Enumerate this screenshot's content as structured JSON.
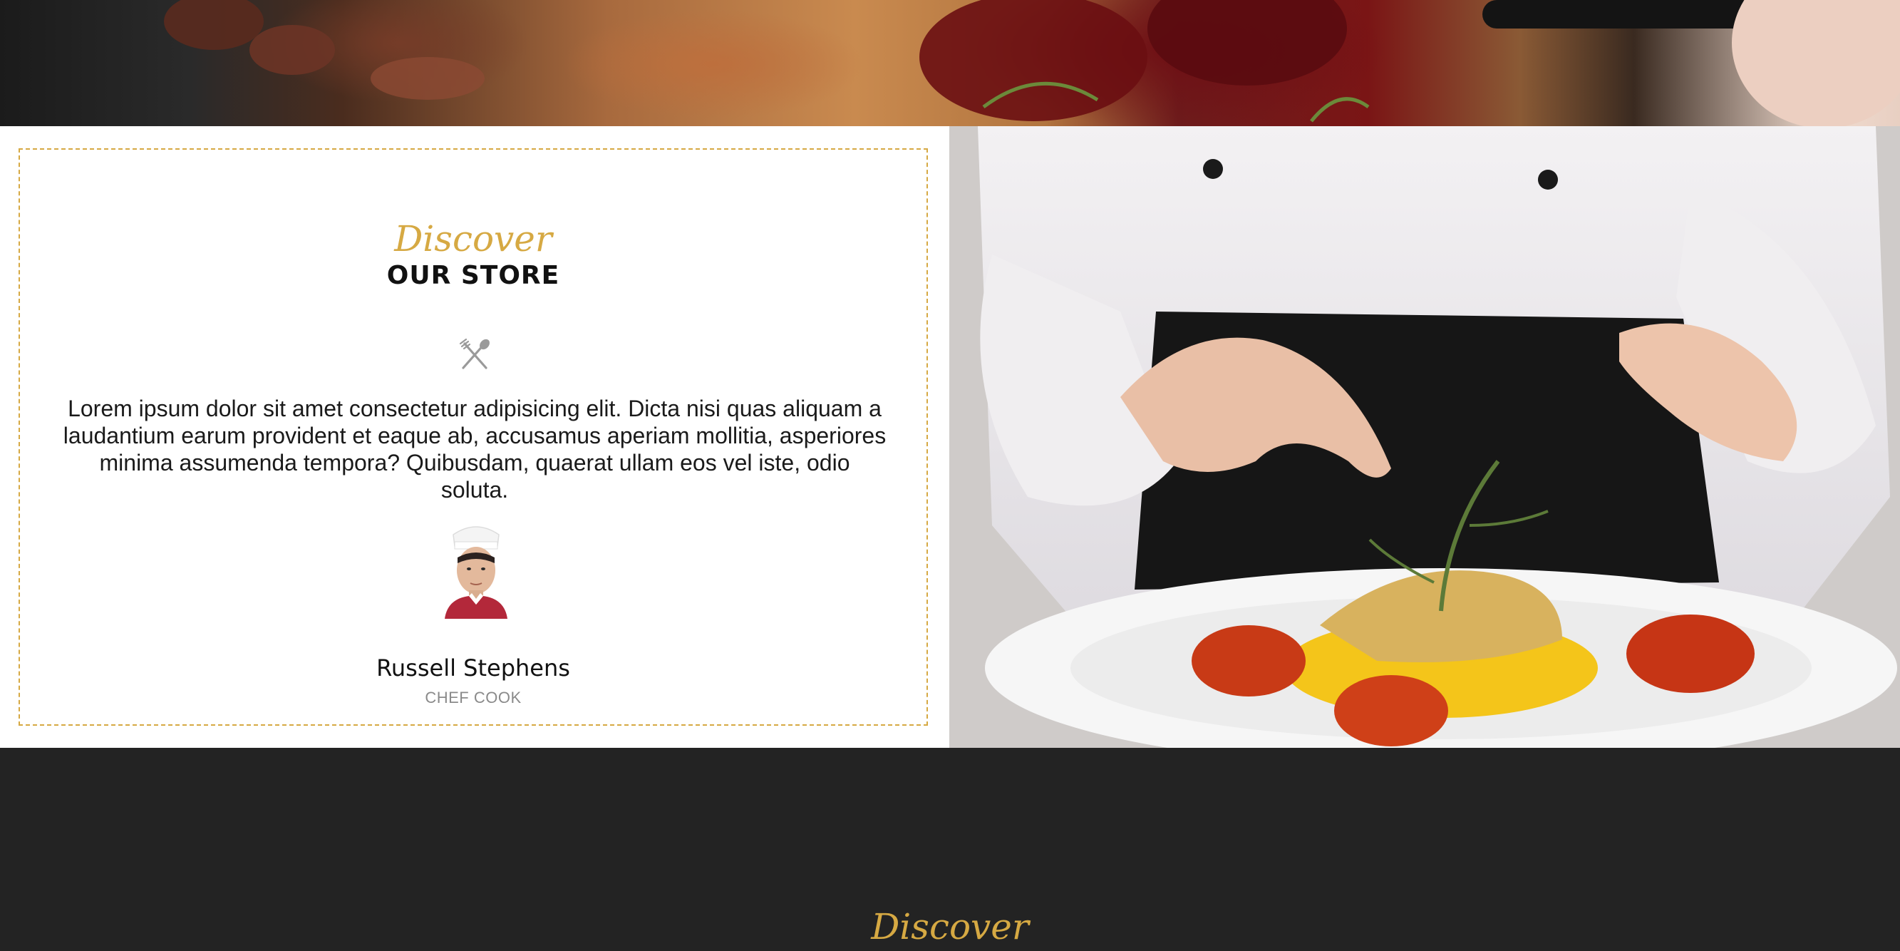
{
  "store": {
    "script_title": "Discover",
    "heading": "OUR STORE",
    "description": "Lorem ipsum dolor sit amet consectetur adipisicing elit. Dicta nisi quas aliquam a laudantium earum provident et eaque ab, accusamus aperiam mollitia, asperiores minima assumenda tempora? Quibusdam, quaerat ullam eos vel iste, odio soluta.",
    "chef": {
      "name": "Russell Stephens",
      "role": "CHEF COOK"
    },
    "icon": "fork-spoon-icon"
  },
  "next_section": {
    "script_title": "Discover"
  },
  "colors": {
    "accent": "#d6a943",
    "dark_background": "#232323",
    "text": "#1a1a1a",
    "muted": "#8a8a8a"
  }
}
